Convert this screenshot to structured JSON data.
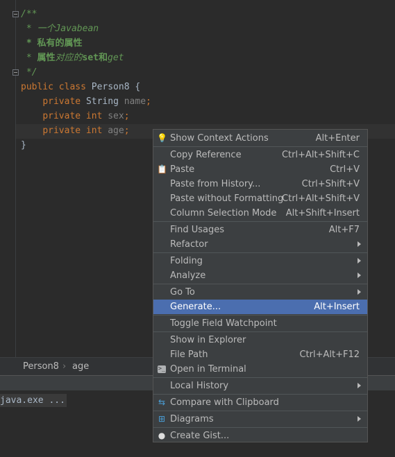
{
  "editor": {
    "lines": [
      {
        "kind": "comment",
        "text": "/**"
      },
      {
        "kind": "comment",
        "text": " * 一个Javabean"
      },
      {
        "kind": "comment-bold",
        "text": " * 私有的属性"
      },
      {
        "kind": "comment-mixed",
        "prefix": " * ",
        "bold1": "属性",
        "mid": "对应的",
        "bold2": "set和",
        "tail": "get"
      },
      {
        "kind": "comment",
        "text": " */"
      },
      {
        "kind": "code",
        "kw": "public class ",
        "name": "Person8 {"
      },
      {
        "kind": "field",
        "kw": "private ",
        "type": "String ",
        "field": "name",
        "end": ";"
      },
      {
        "kind": "field",
        "kw": "private int ",
        "type": "",
        "field": "sex",
        "end": ";"
      },
      {
        "kind": "field",
        "kw": "private int ",
        "type": "",
        "field": "age",
        "end": ";"
      },
      {
        "kind": "code",
        "kw": "",
        "name": "}"
      }
    ]
  },
  "breadcrumb": {
    "class": "Person8",
    "sep": "›",
    "member": "age"
  },
  "run": {
    "line": "java.exe ..."
  },
  "menu": {
    "items": [
      {
        "label": "Show Context Actions",
        "shortcut": "Alt+Enter",
        "icon": "bulb-icon",
        "glyph": "💡"
      },
      {
        "label": "Copy Reference",
        "shortcut": "Ctrl+Alt+Shift+C"
      },
      {
        "label": "Paste",
        "shortcut": "Ctrl+V",
        "icon": "clipboard-icon",
        "glyph": "📋"
      },
      {
        "label": "Paste from History...",
        "shortcut": "Ctrl+Shift+V"
      },
      {
        "label": "Paste without Formatting",
        "shortcut": "Ctrl+Alt+Shift+V"
      },
      {
        "label": "Column Selection Mode",
        "shortcut": "Alt+Shift+Insert"
      },
      {
        "label": "Find Usages",
        "shortcut": "Alt+F7"
      },
      {
        "label": "Refactor",
        "submenu": true
      },
      {
        "label": "Folding",
        "submenu": true
      },
      {
        "label": "Analyze",
        "submenu": true
      },
      {
        "label": "Go To",
        "submenu": true
      },
      {
        "label": "Generate...",
        "shortcut": "Alt+Insert",
        "selected": true
      },
      {
        "label": "Toggle Field Watchpoint"
      },
      {
        "label": "Show in Explorer"
      },
      {
        "label": "File Path",
        "shortcut": "Ctrl+Alt+F12"
      },
      {
        "label": "Open in Terminal",
        "icon": "terminal-icon",
        "glyph": ">_"
      },
      {
        "label": "Local History",
        "submenu": true
      },
      {
        "label": "Compare with Clipboard",
        "icon": "compare-icon",
        "glyph": "⇆"
      },
      {
        "label": "Diagrams",
        "submenu": true,
        "icon": "diagram-icon",
        "glyph": "⊞"
      },
      {
        "label": "Create Gist...",
        "icon": "github-icon",
        "glyph": "●"
      }
    ]
  }
}
